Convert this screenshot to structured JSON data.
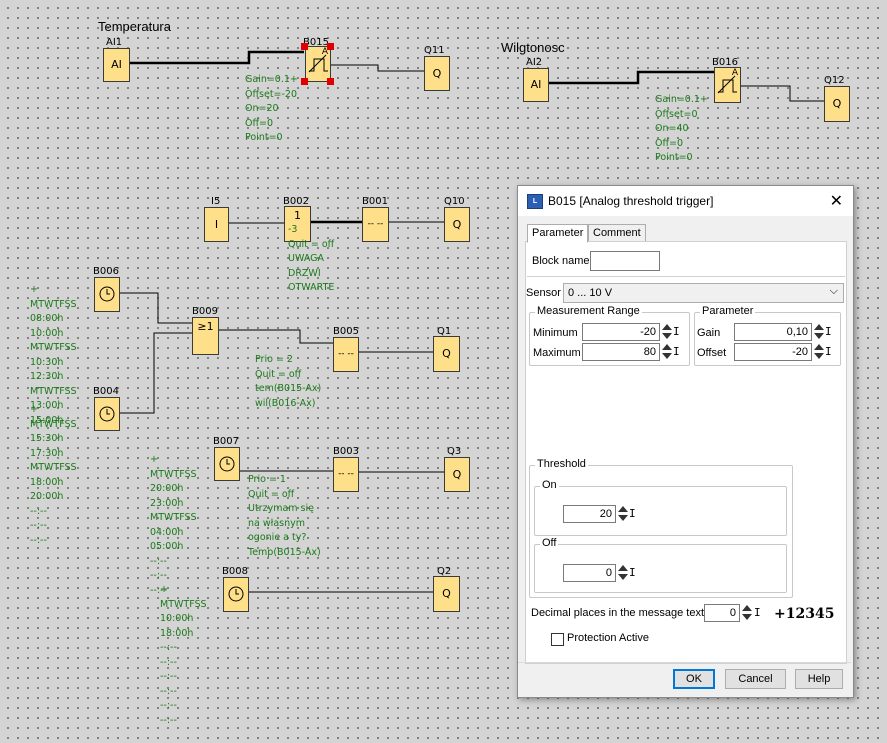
{
  "diagram": {
    "titles": {
      "temperatura": "Temperatura",
      "wilgotnosc": "Wilgtonosc"
    },
    "blocks": {
      "AI1": {
        "label": "AI1",
        "glyph": "AI"
      },
      "AI2": {
        "label": "AI2",
        "glyph": "AI"
      },
      "B015": {
        "label": "B015",
        "glyph": "A"
      },
      "B016": {
        "label": "B016",
        "glyph": "A"
      },
      "Q11": {
        "label": "Q11",
        "glyph": "Q"
      },
      "Q12": {
        "label": "Q12",
        "glyph": "Q"
      },
      "I5": {
        "label": "I5",
        "glyph": "I"
      },
      "B002": {
        "label": "B002",
        "glyph": "1"
      },
      "B001": {
        "label": "B001",
        "glyph": "-- --"
      },
      "Q10": {
        "label": "Q10",
        "glyph": "Q"
      },
      "B006": {
        "label": "B006",
        "glyph": "clock"
      },
      "B009": {
        "label": "B009",
        "glyph": "≥1"
      },
      "B005": {
        "label": "B005",
        "glyph": "-- --"
      },
      "Q1": {
        "label": "Q1",
        "glyph": "Q"
      },
      "B004": {
        "label": "B004",
        "glyph": "clock"
      },
      "B007": {
        "label": "B007",
        "glyph": "clock"
      },
      "B003": {
        "label": "B003",
        "glyph": "-- --"
      },
      "Q3": {
        "label": "Q3",
        "glyph": "Q"
      },
      "B008": {
        "label": "B008",
        "glyph": "clock"
      },
      "Q2": {
        "label": "Q2",
        "glyph": "Q"
      }
    },
    "params": {
      "B015": "Gain=0.1+\nOffset=-20\nOn=20\nOff=0\nPoint=0",
      "B016": "Gain=0.1+\nOffset=0\nOn=40\nOff=0\nPoint=0",
      "B002": "-3\nQuit = off\nUWAGA\nDRZWI\nOTWARTE",
      "B006": "+\nMTWTFSS\n08:00h\n10:00h\nMTWTFSS\n10:30h\n12:30h\nMTWTFSS\n13:00h\n15:00h",
      "B004": "+\nMTWTFSS\n15:30h\n17:30h\nMTWTFSS\n18:00h\n20:00h\n--:--\n--:--\n--:--",
      "B005": "Prio = 2\nQuit = off\ntem(B015-Ax)\nwil(B016-Ax)",
      "B007": "+\nMTWTFSS\n20:00h\n23:00h\nMTWTFSS\n04:00h\n05:00h\n--:--\n--:--\n--:--",
      "B003": "Prio = 1\nQuit = off\nUtrzymam się\nna własnym\nogonie a ty?\nTemp(B015-Ax)",
      "B008": "+\nMTWTFSS\n10:00h\n18:00h\n--:--\n--:--\n--:--\n--:--\n--:--\n--:--"
    }
  },
  "dialog": {
    "title": "B015 [Analog threshold trigger]",
    "app_icon": "logo-icon",
    "tabs": [
      "Parameter",
      "Comment"
    ],
    "active_tab": "Parameter",
    "block_name_label": "Block name",
    "block_name_value": "",
    "sensor_label": "Sensor",
    "sensor_value": "0 ... 10 V",
    "measurement_range": {
      "title": "Measurement Range",
      "min_label": "Minimum",
      "min_value": "-20",
      "max_label": "Maximum",
      "max_value": "80"
    },
    "parameter": {
      "title": "Parameter",
      "gain_label": "Gain",
      "gain_value": "0,10",
      "offset_label": "Offset",
      "offset_value": "-20"
    },
    "threshold": {
      "title": "Threshold",
      "on_label": "On",
      "on_value": "20",
      "off_label": "Off",
      "off_value": "0"
    },
    "decimal_label": "Decimal places in the message text",
    "decimal_value": "0",
    "preview": "+12345",
    "protection_label": "Protection Active",
    "protection_checked": false,
    "buttons": {
      "ok": "OK",
      "cancel": "Cancel",
      "help": "Help"
    }
  }
}
